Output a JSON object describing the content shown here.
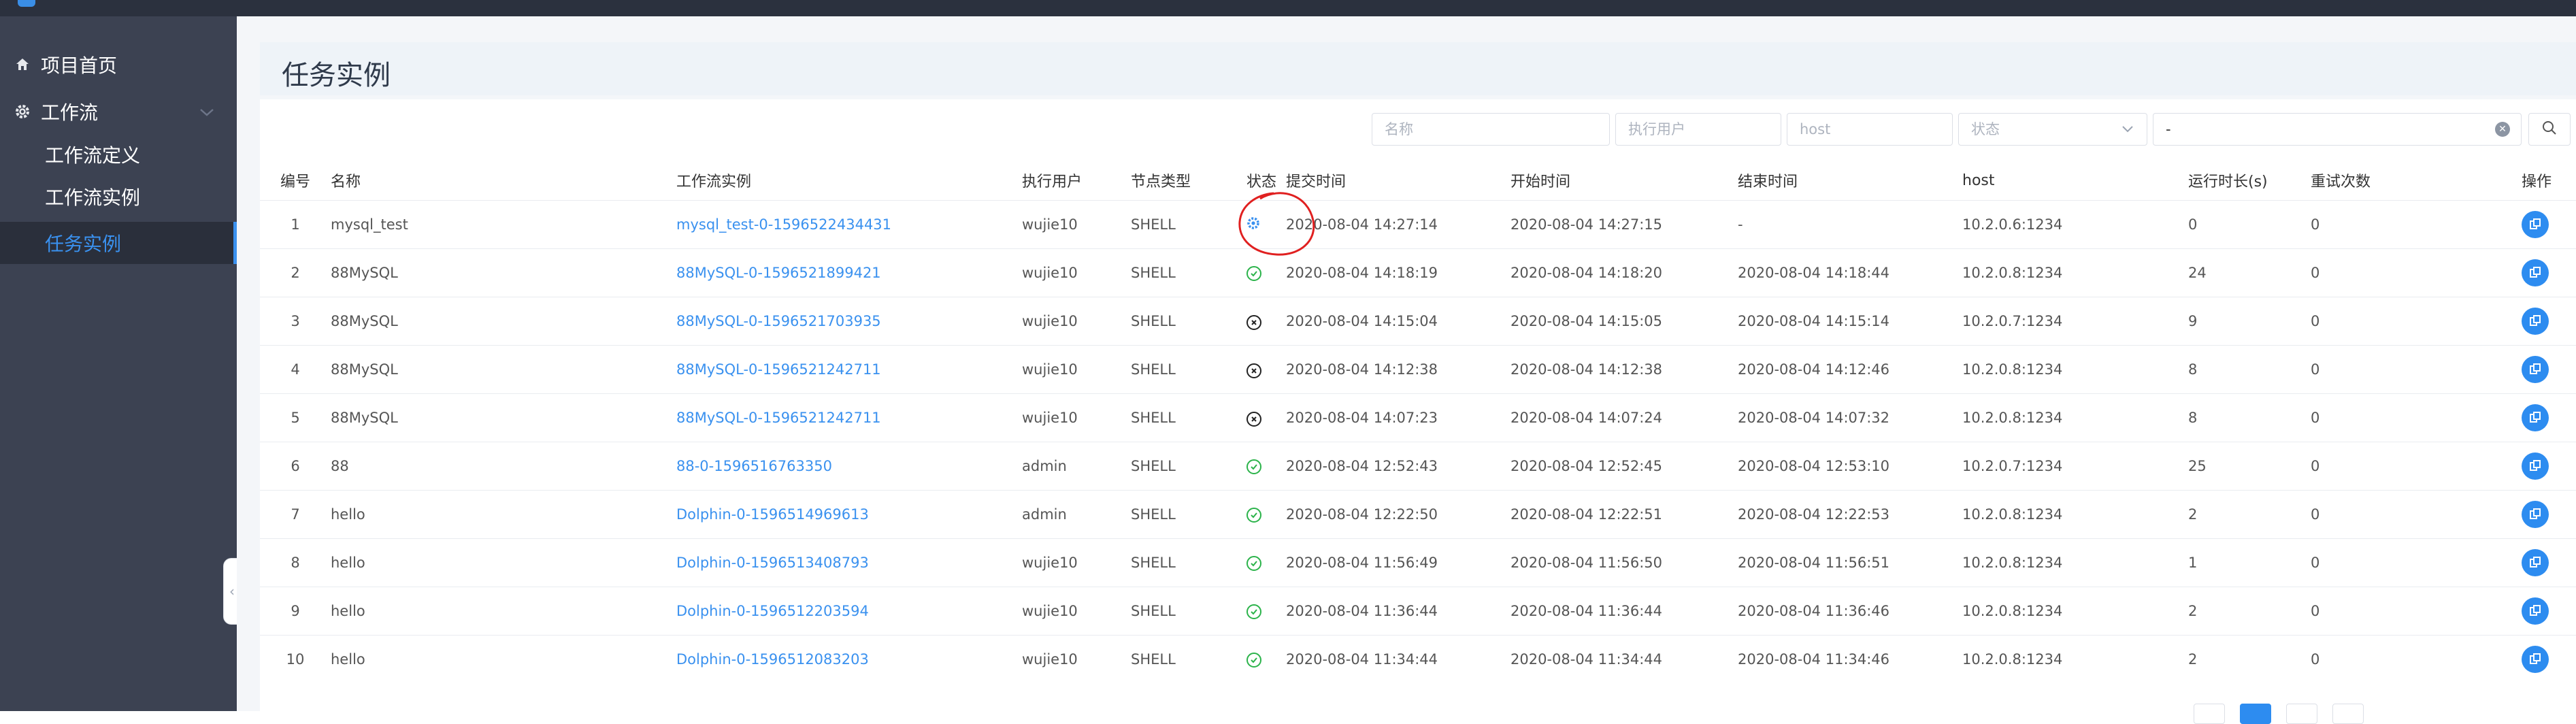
{
  "sidebar": {
    "items": [
      {
        "label": "项目首页",
        "icon": "home-icon"
      },
      {
        "label": "工作流",
        "icon": "gear-icon"
      }
    ],
    "sub_items": [
      {
        "label": "工作流定义"
      },
      {
        "label": "工作流实例"
      },
      {
        "label": "任务实例"
      }
    ]
  },
  "page": {
    "title": "任务实例"
  },
  "filters": {
    "name_placeholder": "名称",
    "user_placeholder": "执行用户",
    "host_placeholder": "host",
    "state_placeholder": "状态",
    "date_value": "-"
  },
  "table": {
    "headers": [
      "编号",
      "名称",
      "工作流实例",
      "执行用户",
      "节点类型",
      "状态",
      "提交时间",
      "开始时间",
      "结束时间",
      "host",
      "运行时长(s)",
      "重试次数",
      "操作"
    ],
    "rows": [
      {
        "id": "1",
        "name": "mysql_test",
        "instance": "mysql_test-0-1596522434431",
        "user": "wujie10",
        "type": "SHELL",
        "status": "running",
        "submit": "2020-08-04 14:27:14",
        "start": "2020-08-04 14:27:15",
        "end": "-",
        "host": "10.2.0.6:1234",
        "duration": "0",
        "retry": "0"
      },
      {
        "id": "2",
        "name": "88MySQL",
        "instance": "88MySQL-0-1596521899421",
        "user": "wujie10",
        "type": "SHELL",
        "status": "success",
        "submit": "2020-08-04 14:18:19",
        "start": "2020-08-04 14:18:20",
        "end": "2020-08-04 14:18:44",
        "host": "10.2.0.8:1234",
        "duration": "24",
        "retry": "0"
      },
      {
        "id": "3",
        "name": "88MySQL",
        "instance": "88MySQL-0-1596521703935",
        "user": "wujie10",
        "type": "SHELL",
        "status": "failed",
        "submit": "2020-08-04 14:15:04",
        "start": "2020-08-04 14:15:05",
        "end": "2020-08-04 14:15:14",
        "host": "10.2.0.7:1234",
        "duration": "9",
        "retry": "0"
      },
      {
        "id": "4",
        "name": "88MySQL",
        "instance": "88MySQL-0-1596521242711",
        "user": "wujie10",
        "type": "SHELL",
        "status": "failed",
        "submit": "2020-08-04 14:12:38",
        "start": "2020-08-04 14:12:38",
        "end": "2020-08-04 14:12:46",
        "host": "10.2.0.8:1234",
        "duration": "8",
        "retry": "0"
      },
      {
        "id": "5",
        "name": "88MySQL",
        "instance": "88MySQL-0-1596521242711",
        "user": "wujie10",
        "type": "SHELL",
        "status": "failed",
        "submit": "2020-08-04 14:07:23",
        "start": "2020-08-04 14:07:24",
        "end": "2020-08-04 14:07:32",
        "host": "10.2.0.8:1234",
        "duration": "8",
        "retry": "0"
      },
      {
        "id": "6",
        "name": "88",
        "instance": "88-0-1596516763350",
        "user": "admin",
        "type": "SHELL",
        "status": "success",
        "submit": "2020-08-04 12:52:43",
        "start": "2020-08-04 12:52:45",
        "end": "2020-08-04 12:53:10",
        "host": "10.2.0.7:1234",
        "duration": "25",
        "retry": "0"
      },
      {
        "id": "7",
        "name": "hello",
        "instance": "Dolphin-0-1596514969613",
        "user": "admin",
        "type": "SHELL",
        "status": "success",
        "submit": "2020-08-04 12:22:50",
        "start": "2020-08-04 12:22:51",
        "end": "2020-08-04 12:22:53",
        "host": "10.2.0.8:1234",
        "duration": "2",
        "retry": "0"
      },
      {
        "id": "8",
        "name": "hello",
        "instance": "Dolphin-0-1596513408793",
        "user": "wujie10",
        "type": "SHELL",
        "status": "success",
        "submit": "2020-08-04 11:56:49",
        "start": "2020-08-04 11:56:50",
        "end": "2020-08-04 11:56:51",
        "host": "10.2.0.8:1234",
        "duration": "1",
        "retry": "0"
      },
      {
        "id": "9",
        "name": "hello",
        "instance": "Dolphin-0-1596512203594",
        "user": "wujie10",
        "type": "SHELL",
        "status": "success",
        "submit": "2020-08-04 11:36:44",
        "start": "2020-08-04 11:36:44",
        "end": "2020-08-04 11:36:46",
        "host": "10.2.0.8:1234",
        "duration": "2",
        "retry": "0"
      },
      {
        "id": "10",
        "name": "hello",
        "instance": "Dolphin-0-1596512083203",
        "user": "wujie10",
        "type": "SHELL",
        "status": "success",
        "submit": "2020-08-04 11:34:44",
        "start": "2020-08-04 11:34:44",
        "end": "2020-08-04 11:34:46",
        "host": "10.2.0.8:1234",
        "duration": "2",
        "retry": "0"
      }
    ]
  },
  "colors": {
    "sidebar_bg": "#3c4252",
    "active_blue": "#3a91ef",
    "success_green": "#2bb34a",
    "action_blue": "#2d8cf0"
  }
}
